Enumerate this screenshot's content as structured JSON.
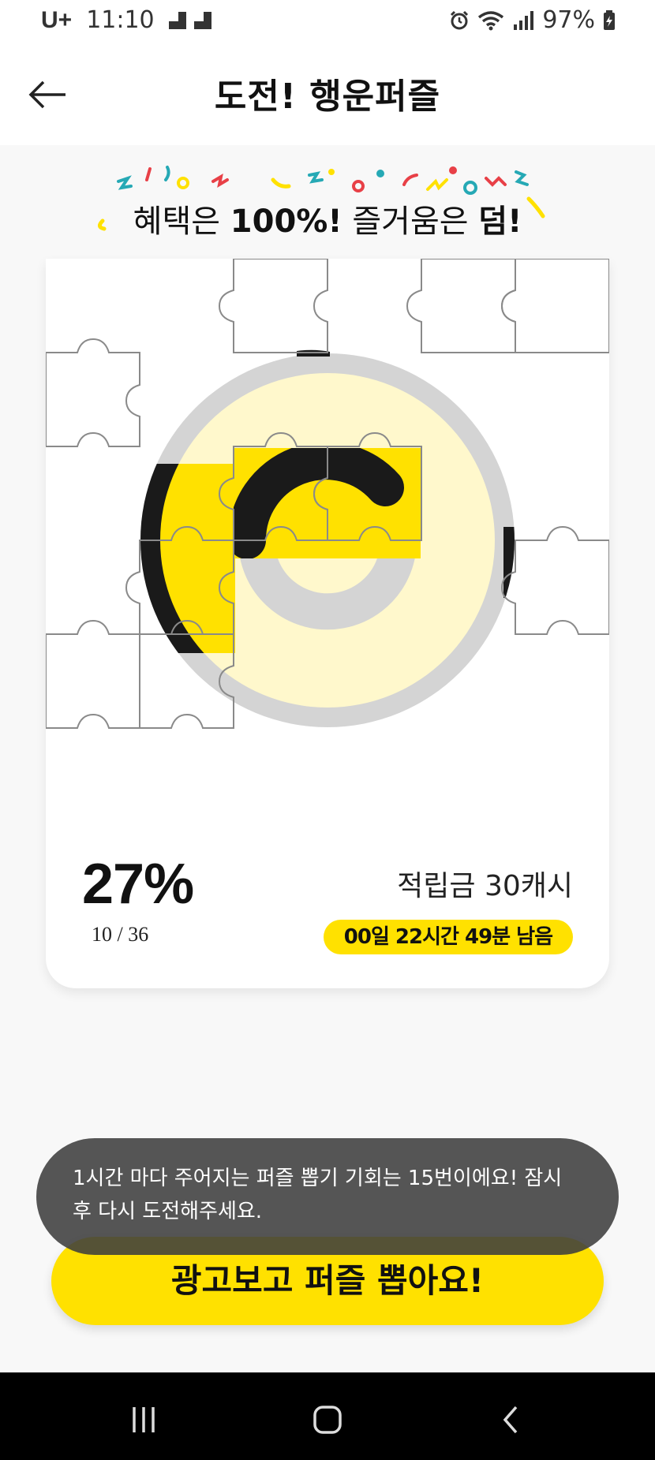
{
  "status_bar": {
    "carrier": "U+",
    "time": "11:10",
    "battery": "97%",
    "icons": [
      "alarm-icon",
      "wifi-icon",
      "signal-icon",
      "battery-charging-icon"
    ]
  },
  "header": {
    "title": "도전! 행운퍼즐",
    "back_icon": "arrow-left-icon"
  },
  "banner": {
    "text_prefix": "혜택은 ",
    "text_bold_1": "100%!",
    "text_middle": " 즐거움은 ",
    "text_bold_2": "덤!"
  },
  "puzzle": {
    "progress_percent": "27%",
    "progress_count": "10 / 36",
    "collected_pieces": 10,
    "total_pieces": 36,
    "reward": "적립금 30캐시",
    "time_left": "00일 22시간 49분 남음",
    "colors": {
      "yellow": "#ffe100",
      "light_yellow": "#fff8cc",
      "ring_gray": "#d4d4d4",
      "black": "#1a1a1a"
    }
  },
  "toast": {
    "message": "1시간 마다 주어지는 퍼즐 뽑기 기회는 15번이에요! 잠시 후 다시 도전해주세요."
  },
  "cta": {
    "label": "광고보고 퍼즐 뽑아요!"
  },
  "nav_bar": {
    "icons": [
      "recent-apps-icon",
      "home-icon",
      "back-icon"
    ]
  }
}
